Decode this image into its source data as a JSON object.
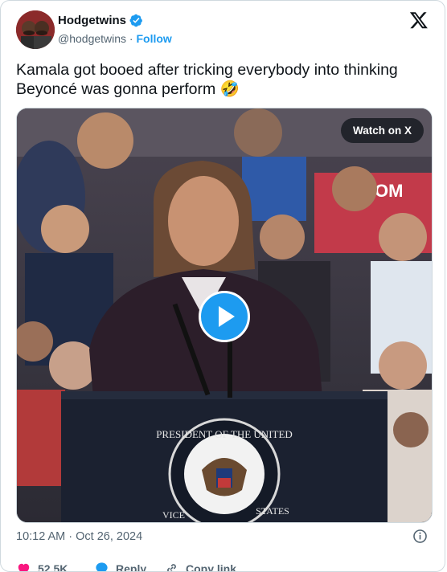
{
  "author": {
    "display_name": "Hodgetwins",
    "handle": "@hodgetwins",
    "separator": " · ",
    "follow_label": "Follow"
  },
  "tweet": {
    "text": "Kamala got booed after tricking everybody into thinking Beyoncé was gonna perform 🤣",
    "timestamp": "10:12 AM · Oct 26, 2024"
  },
  "media": {
    "watch_label": "Watch on X",
    "podium_seal_text": "PRESIDENT OF THE UNITED STATES",
    "podium_seal_text_top": "PRESIDENT OF THE UNITED",
    "podium_seal_text_side_left": "VICE",
    "podium_seal_text_side_right": "STATES",
    "sign_text": "BOOM BOOM"
  },
  "actions": {
    "like_count": "52.5K",
    "reply_label": "Reply",
    "copy_link_label": "Copy link"
  },
  "colors": {
    "accent": "#1d9bf0",
    "like": "#f91880",
    "text_secondary": "#536471"
  },
  "icons": {
    "verified": "verified-badge-icon",
    "x_logo": "x-logo-icon",
    "play": "play-icon",
    "info": "info-icon",
    "like": "heart-icon",
    "reply": "reply-icon",
    "copy": "link-icon"
  }
}
